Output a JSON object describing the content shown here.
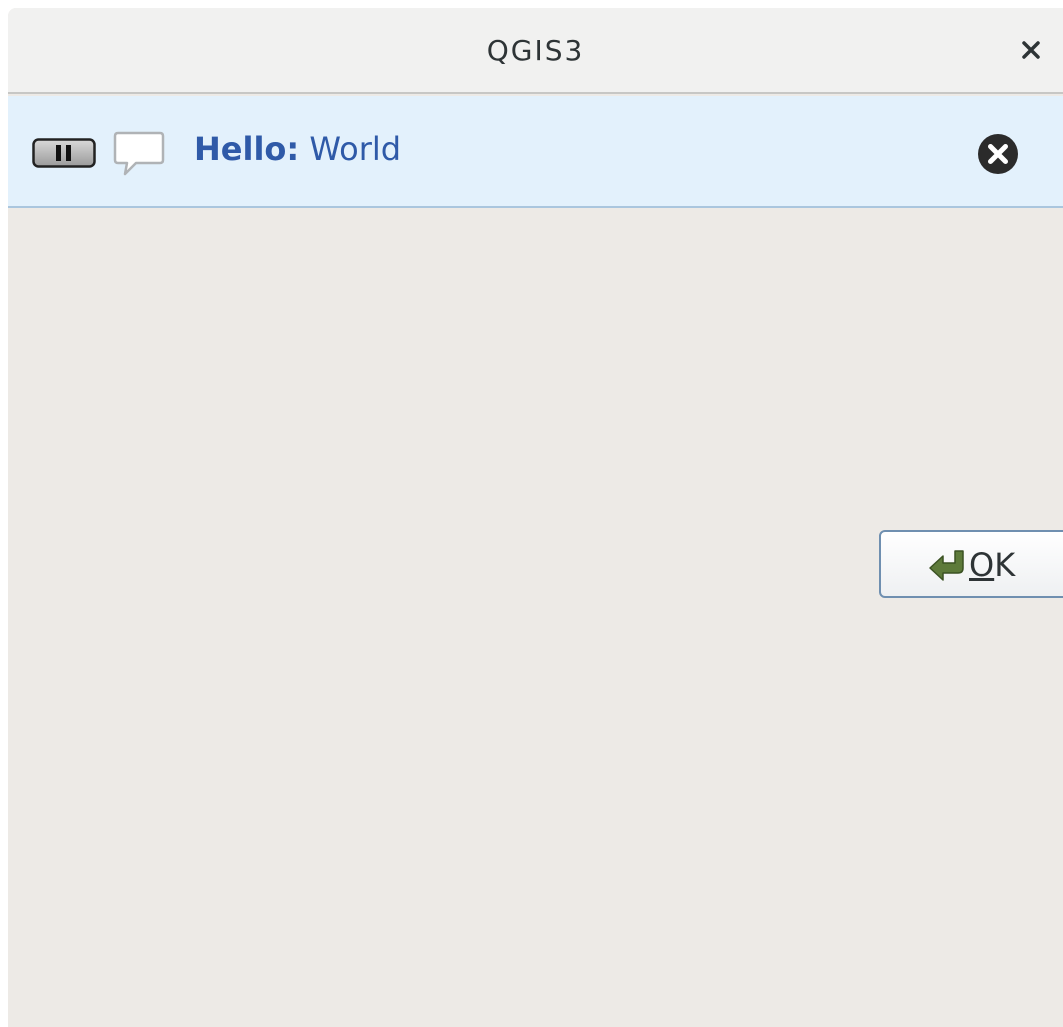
{
  "window": {
    "title": "QGIS3"
  },
  "message_bar": {
    "title": "Hello:",
    "text": "World",
    "background_color": "#e3f1fc",
    "text_color": "#2f5aa8",
    "icons": {
      "pause": "pause-icon",
      "message": "speech-bubble-icon",
      "dismiss": "close-circle-icon"
    }
  },
  "buttons": {
    "ok": {
      "mnemonic": "O",
      "rest": "K",
      "icon": "return-arrow-icon"
    }
  },
  "colors": {
    "window_bg": "#edeae6",
    "titlebar_bg": "#f1f1f0"
  }
}
